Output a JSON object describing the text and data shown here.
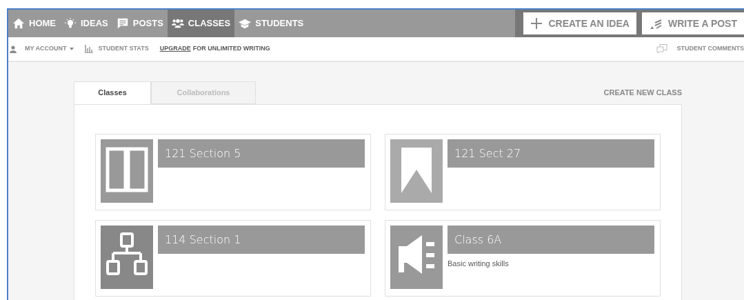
{
  "nav": [
    {
      "label": "HOME",
      "kind": "home",
      "selected": false
    },
    {
      "label": "IDEAS",
      "kind": "bulb",
      "selected": false
    },
    {
      "label": "POSTS",
      "kind": "post",
      "selected": false
    },
    {
      "label": "CLASSES",
      "kind": "people",
      "selected": true
    },
    {
      "label": "STUDENTS",
      "kind": "cap",
      "selected": false
    }
  ],
  "actions": [
    {
      "label": "CREATE AN IDEA",
      "kind": "plus"
    },
    {
      "label": "WRITE A POST",
      "kind": "pen"
    }
  ],
  "subnav": {
    "account": "MY ACCOUNT",
    "stats": "STUDENT STATS",
    "upgrade_link": "UPGRADE",
    "upgrade_text": "FOR UNLIMITED WRITING",
    "comments": "STUDENT COMMENTS"
  },
  "tabs": [
    {
      "label": "Classes",
      "selected": true
    },
    {
      "label": "Collaborations",
      "selected": false
    }
  ],
  "create_class": "CREATE NEW CLASS",
  "classes": [
    {
      "name": "121 Section 5",
      "kind": "book"
    },
    {
      "name": "121 Sect 27",
      "kind": "bookmark"
    },
    {
      "name": "114 Section 1",
      "kind": "hierarchy"
    },
    {
      "name": "Class 6A",
      "kind": "megaphone",
      "description": "Basic writing skills"
    }
  ]
}
